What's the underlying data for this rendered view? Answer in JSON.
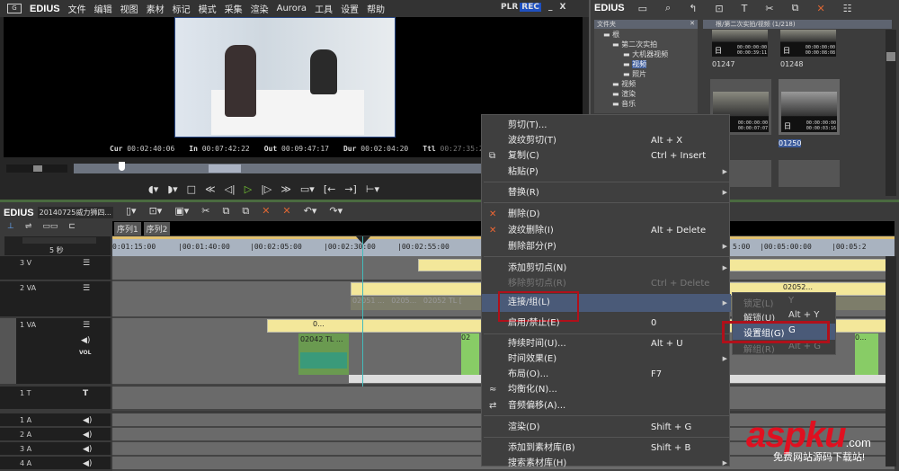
{
  "preview": {
    "app": "EDIUS",
    "menu": [
      "文件",
      "编辑",
      "视图",
      "素材",
      "标记",
      "模式",
      "采集",
      "渲染",
      "Aurora",
      "工具",
      "设置",
      "帮助"
    ],
    "plr": "PLR",
    "rec": "REC",
    "minimize": "_",
    "close": "X",
    "timecodes": [
      {
        "label": "Cur",
        "value": "00:02:40:06"
      },
      {
        "label": "In",
        "value": "00:07:42:22"
      },
      {
        "label": "Out",
        "value": "00:09:47:17"
      },
      {
        "label": "Dur",
        "value": "00:02:04:20"
      },
      {
        "label": "Ttl",
        "value": "00:27:35:24"
      }
    ],
    "transport": [
      "set-in",
      "set-out",
      "stop",
      "rewind",
      "step-back",
      "play",
      "step-forward",
      "fast-forward",
      "loop",
      "insert",
      "overwrite",
      "replace",
      "output"
    ]
  },
  "bin": {
    "app": "EDIUS",
    "folder_header": "文件夹",
    "path": "根/第二次实拍/视频 (1/218)",
    "tree": [
      {
        "label": "根",
        "level": 0
      },
      {
        "label": "第二次实拍",
        "level": 1
      },
      {
        "label": "大机器视频",
        "level": 2
      },
      {
        "label": "视频",
        "level": 2,
        "selected": true
      },
      {
        "label": "照片",
        "level": 2
      },
      {
        "label": "视频",
        "level": 1
      },
      {
        "label": "渲染",
        "level": 1
      },
      {
        "label": "音乐",
        "level": 1
      }
    ],
    "clips": [
      {
        "name": "01247",
        "tc1": "00:00:00:00",
        "tc2": "00:00:39:11"
      },
      {
        "name": "01248",
        "tc1": "00:00:00:00",
        "tc2": "00:00:08:08"
      },
      {
        "name": "",
        "tc1": "00:00:00:00",
        "tc2": "00:00:07:07"
      },
      {
        "name": "01250",
        "tc1": "00:00:00:00",
        "tc2": "00:00:03:16",
        "selected": true
      }
    ]
  },
  "timeline": {
    "app": "EDIUS",
    "project": "20140725威力狮四...",
    "tabs": [
      "序列1",
      "序列2"
    ],
    "zoom": "5 秒",
    "ruler": [
      "0:01:15:00",
      "|00:01:40:00",
      "|00:02:05:00",
      "|00:02:30:00",
      "|00:02:55:00",
      "5:00",
      "|00:05:00:00",
      "|00:05:2"
    ],
    "tracks": [
      {
        "name": "3 V"
      },
      {
        "name": "2 VA"
      },
      {
        "name": "1 VA",
        "vol": "VOL"
      },
      {
        "name": "1 T"
      },
      {
        "name": "1 A"
      },
      {
        "name": "2 A"
      },
      {
        "name": "3 A"
      },
      {
        "name": "4 A"
      }
    ],
    "clips": {
      "c1": "02052...",
      "c2": "02051 ...",
      "c3": "0205...",
      "c4": "02052 TL [",
      "c5": "0...",
      "c6": "02042 TL ...",
      "c7": "02",
      "c8": "0..."
    }
  },
  "context_menu": {
    "items": [
      {
        "label": "剪切(T)...",
        "shortcut": ""
      },
      {
        "label": "波纹剪切(T)",
        "shortcut": "Alt + X"
      },
      {
        "label": "复制(C)",
        "shortcut": "Ctrl + Insert"
      },
      {
        "label": "粘贴(P)",
        "shortcut": ""
      },
      {
        "label": "替换(R)",
        "shortcut": ""
      },
      {
        "label": "删除(D)",
        "shortcut": ""
      },
      {
        "label": "波纹删除(I)",
        "shortcut": "Alt + Delete"
      },
      {
        "label": "删除部分(P)",
        "shortcut": ""
      },
      {
        "label": "添加剪切点(N)",
        "shortcut": ""
      },
      {
        "label": "移除剪切点(R)",
        "shortcut": "Ctrl + Delete"
      },
      {
        "label": "连接/组(L)",
        "shortcut": ""
      },
      {
        "label": "启用/禁止(E)",
        "shortcut": "0"
      },
      {
        "label": "持续时间(U)...",
        "shortcut": "Alt + U"
      },
      {
        "label": "时间效果(E)",
        "shortcut": ""
      },
      {
        "label": "布局(O)...",
        "shortcut": "F7"
      },
      {
        "label": "均衡化(N)...",
        "shortcut": ""
      },
      {
        "label": "音频偏移(A)...",
        "shortcut": ""
      },
      {
        "label": "渲染(D)",
        "shortcut": "Shift + G"
      },
      {
        "label": "添加到素材库(B)",
        "shortcut": "Shift + B"
      },
      {
        "label": "搜索素材库(H)",
        "shortcut": ""
      }
    ],
    "submenu": [
      {
        "label": "锁定(L)",
        "shortcut": "Y"
      },
      {
        "label": "解锁(U)",
        "shortcut": "Alt + Y"
      },
      {
        "label": "设置组(G)",
        "shortcut": "G"
      },
      {
        "label": "解组(R)",
        "shortcut": "Alt + G"
      }
    ]
  },
  "watermark": {
    "brand": "aspku",
    "domain": ".com",
    "slogan": "免费网站源码下载站!"
  },
  "colors": {
    "highlight": "#4a5a78",
    "redbox": "#b0101a",
    "clip": "#f3e79a",
    "audio": "#3a9a7a",
    "rec": "#1e50c0"
  }
}
